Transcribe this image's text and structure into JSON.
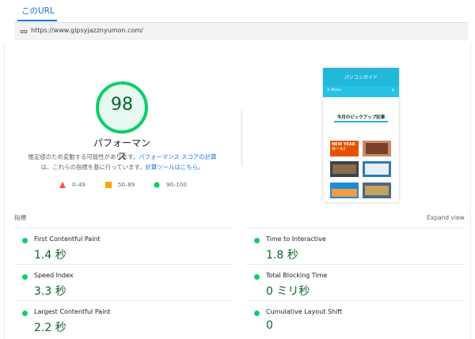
{
  "tab": {
    "label": "このURL"
  },
  "url_bar": {
    "url": "https://www.gipsyjazznyumon.com/"
  },
  "score": {
    "value": "98",
    "fraction": 0.98,
    "title": "パフォーマンス",
    "color": "#0cce6b"
  },
  "description": {
    "prefix": "推定値のため変動する可能性があります。",
    "link1": "パフォーマンス スコアの計算",
    "middle": "は、これらの指標を基に行っています。",
    "link2": "計算ツールはこちら",
    "suffix": "。"
  },
  "legend": [
    {
      "range": "0–49",
      "shape": "triangle",
      "color": "#ff4e42"
    },
    {
      "range": "50–89",
      "shape": "square",
      "color": "#ffa400"
    },
    {
      "range": "90–100",
      "shape": "circle",
      "color": "#0cce6b"
    }
  ],
  "screenshot": {
    "site_title": "パソコンガイド",
    "nav_menu": "≡ Menu",
    "nav_search_icon": "search-icon",
    "pickup_title": "今月のピックアップ記事",
    "thumb1_text": "NEW YEAR\nセール!",
    "thumb3_text": "",
    "thumb5_text": "",
    "thumb6_text": ""
  },
  "metrics_header": {
    "label": "指標",
    "expand": "Expand view"
  },
  "metrics": [
    {
      "name": "First Contentful Paint",
      "value": "1.4 秒"
    },
    {
      "name": "Time to Interactive",
      "value": "1.8 秒"
    },
    {
      "name": "Speed Index",
      "value": "3.3 秒"
    },
    {
      "name": "Total Blocking Time",
      "value": "0 ミリ秒"
    },
    {
      "name": "Largest Contentful Paint",
      "value": "2.2 秒"
    },
    {
      "name": "Cumulative Layout Shift",
      "value": "0"
    }
  ]
}
